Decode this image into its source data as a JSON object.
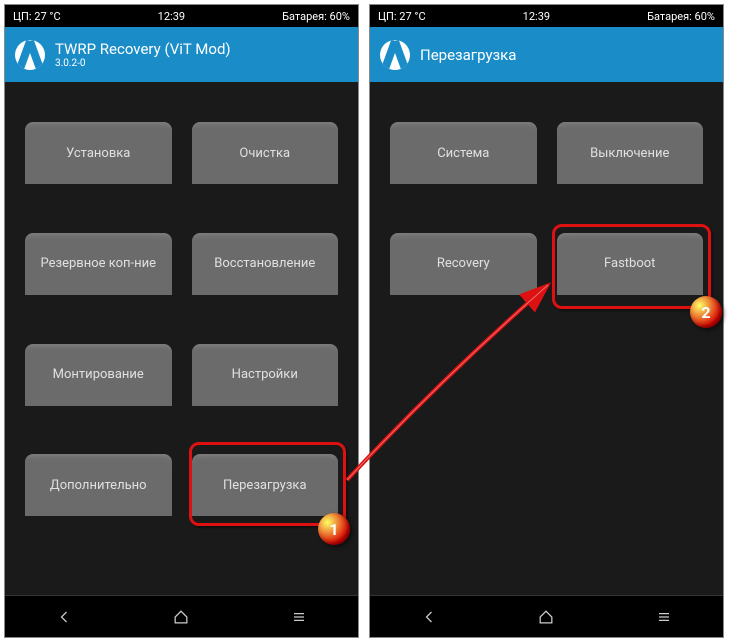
{
  "left": {
    "status": {
      "cpu": "ЦП: 27 °C",
      "time": "12:39",
      "battery": "Батарея: 60%"
    },
    "header": {
      "title": "TWRP Recovery (ViT Mod)",
      "version": "3.0.2-0"
    },
    "buttons": {
      "install": "Установка",
      "wipe": "Очистка",
      "backup": "Резервное коп-ние",
      "restore": "Восстановление",
      "mount": "Монтирование",
      "settings": "Настройки",
      "advanced": "Дополнительно",
      "reboot": "Перезагрузка"
    }
  },
  "right": {
    "status": {
      "cpu": "ЦП: 27 °C",
      "time": "12:39",
      "battery": "Батарея: 60%"
    },
    "header": {
      "title": "Перезагрузка"
    },
    "buttons": {
      "system": "Система",
      "poweroff": "Выключение",
      "recovery": "Recovery",
      "fastboot": "Fastboot"
    }
  },
  "badges": {
    "one": "1",
    "two": "2"
  }
}
